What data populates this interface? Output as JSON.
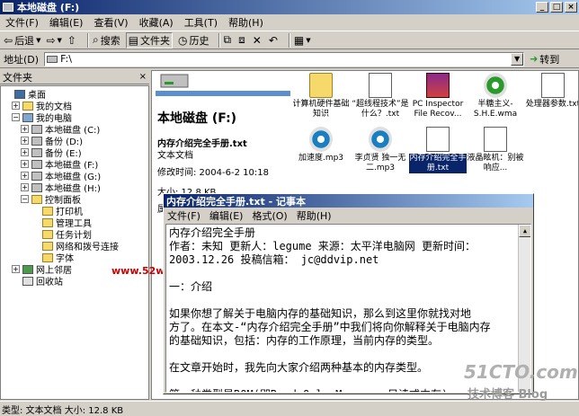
{
  "window": {
    "title": "本地磁盘 (F:)",
    "min": "_",
    "max": "□",
    "close": "×"
  },
  "menubar": [
    "文件(F)",
    "编辑(E)",
    "查看(V)",
    "收藏(A)",
    "工具(T)",
    "帮助(H)"
  ],
  "toolbar": {
    "back": "后退",
    "search": "搜索",
    "folders": "文件夹",
    "history": "历史"
  },
  "address": {
    "label": "地址(D)",
    "value": "F:\\",
    "go": "转到"
  },
  "folders_panel": {
    "title": "文件夹",
    "close": "×"
  },
  "tree": [
    {
      "label": "桌面",
      "level": 0,
      "icon": "desk",
      "expander": ""
    },
    {
      "label": "我的文档",
      "level": 1,
      "icon": "folder",
      "expander": "+"
    },
    {
      "label": "我的电脑",
      "level": 1,
      "icon": "pc",
      "expander": "−"
    },
    {
      "label": "本地磁盘 (C:)",
      "level": 2,
      "icon": "drive",
      "expander": "+"
    },
    {
      "label": "备份 (D:)",
      "level": 2,
      "icon": "drive",
      "expander": "+"
    },
    {
      "label": "备份 (E:)",
      "level": 2,
      "icon": "drive",
      "expander": "+"
    },
    {
      "label": "本地磁盘 (F:)",
      "level": 2,
      "icon": "drive",
      "expander": "+"
    },
    {
      "label": "本地磁盘 (G:)",
      "level": 2,
      "icon": "drive",
      "expander": "+"
    },
    {
      "label": "本地磁盘 (H:)",
      "level": 2,
      "icon": "drive",
      "expander": "+"
    },
    {
      "label": "控制面板",
      "level": 2,
      "icon": "folder",
      "expander": "−"
    },
    {
      "label": "打印机",
      "level": 3,
      "icon": "folder",
      "expander": ""
    },
    {
      "label": "管理工具",
      "level": 3,
      "icon": "folder",
      "expander": ""
    },
    {
      "label": "任务计划",
      "level": 3,
      "icon": "folder",
      "expander": ""
    },
    {
      "label": "网络和拨号连接",
      "level": 3,
      "icon": "folder",
      "expander": ""
    },
    {
      "label": "字体",
      "level": 3,
      "icon": "folder",
      "expander": ""
    },
    {
      "label": "网上邻居",
      "level": 1,
      "icon": "net",
      "expander": "+"
    },
    {
      "label": "回收站",
      "level": 1,
      "icon": "bin",
      "expander": ""
    }
  ],
  "details": {
    "drive_title": "本地磁盘 (F:)",
    "file_name": "内存介绍完全手册.txt",
    "file_type": "文本文档",
    "modified": "修改时间: 2004-6-2 10:18",
    "size": "大小: 12.8 KB",
    "attr": "属"
  },
  "files": [
    {
      "name": "计算机硬件基础知识",
      "type": "folder",
      "selected": false
    },
    {
      "name": "“超线程技术”是什么？.txt",
      "type": "txt",
      "selected": false
    },
    {
      "name": "PC Inspector File Recov...",
      "type": "rar",
      "selected": false
    },
    {
      "name": "半糖主义-S.H.E.wma",
      "type": "wma",
      "selected": false
    },
    {
      "name": "处理器参数.txt",
      "type": "txt",
      "selected": false
    },
    {
      "name": "加速度.mp3",
      "type": "mp3",
      "selected": false
    },
    {
      "name": "李贞贤 独一无二.mp3",
      "type": "mp3",
      "selected": false
    },
    {
      "name": "内存介绍完全手册.txt",
      "type": "txt",
      "selected": true
    },
    {
      "name": "液晶眩机：别被响应...",
      "type": "txt",
      "selected": false
    }
  ],
  "notepad": {
    "title": "内存介绍完全手册.txt - 记事本",
    "menu": [
      "文件(F)",
      "编辑(E)",
      "格式(O)",
      "帮助(H)"
    ],
    "lines": [
      "内存介绍完全手册",
      "作者：未知 更新人：legume 来源：太平洋电脑网 更新时间：",
      "2003.12.26 投稿信箱： jc@ddvip.net",
      "",
      "一：介绍",
      "",
      "    如果你想了解关于电脑内存的基础知识，那么到这里你就找对地",
      "方了。在本文-“内存介绍完全手册”中我们将向你解释关于电脑内存",
      "的基础知识，包括：内存的工作原理，当前内存的类型。",
      "",
      "    在文章开始时，我先向大家介绍两种基本的内存类型。",
      "",
      "    第一种类型是ROM(即Read Only Memory, 只读式内存)。"
    ]
  },
  "statusbar": {
    "text": "类型: 文本文档 大小: 12.8 KB"
  },
  "watermarks": {
    "left": "www.52weixiu.com",
    "site": "51CTO.com",
    "blog": "技术博客 Blog"
  }
}
